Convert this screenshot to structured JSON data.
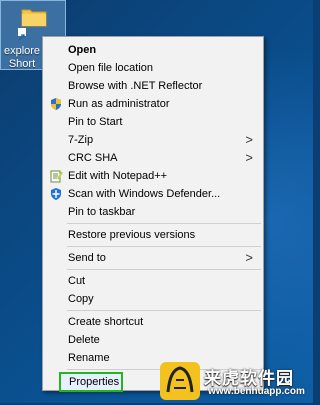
{
  "desktop": {
    "icon_label_line1": "explore",
    "icon_label_line2": "Short"
  },
  "menu": {
    "items": [
      {
        "label": "Open"
      },
      {
        "label": "Open file location"
      },
      {
        "label": "Browse with .NET Reflector"
      },
      {
        "label": "Run as administrator",
        "icon": "shield-icon"
      },
      {
        "label": "Pin to Start"
      },
      {
        "label": "7-Zip",
        "submenu": true
      },
      {
        "label": "CRC SHA",
        "submenu": true
      },
      {
        "label": "Edit with Notepad++",
        "icon": "notepadpp-icon"
      },
      {
        "label": "Scan with Windows Defender...",
        "icon": "defender-icon"
      },
      {
        "label": "Pin to taskbar"
      },
      {
        "label": "Restore previous versions"
      },
      {
        "label": "Send to",
        "submenu": true
      },
      {
        "label": "Cut"
      },
      {
        "label": "Copy"
      },
      {
        "label": "Create shortcut"
      },
      {
        "label": "Delete"
      },
      {
        "label": "Rename"
      },
      {
        "label": "Properties",
        "highlighted": true
      }
    ],
    "submenu_arrow": ">"
  },
  "watermark": {
    "title": "来虎软件园",
    "url": "www.benhuapp.com"
  },
  "colors": {
    "highlight_border": "#25b51f",
    "menu_bg": "#f2f2f2"
  }
}
